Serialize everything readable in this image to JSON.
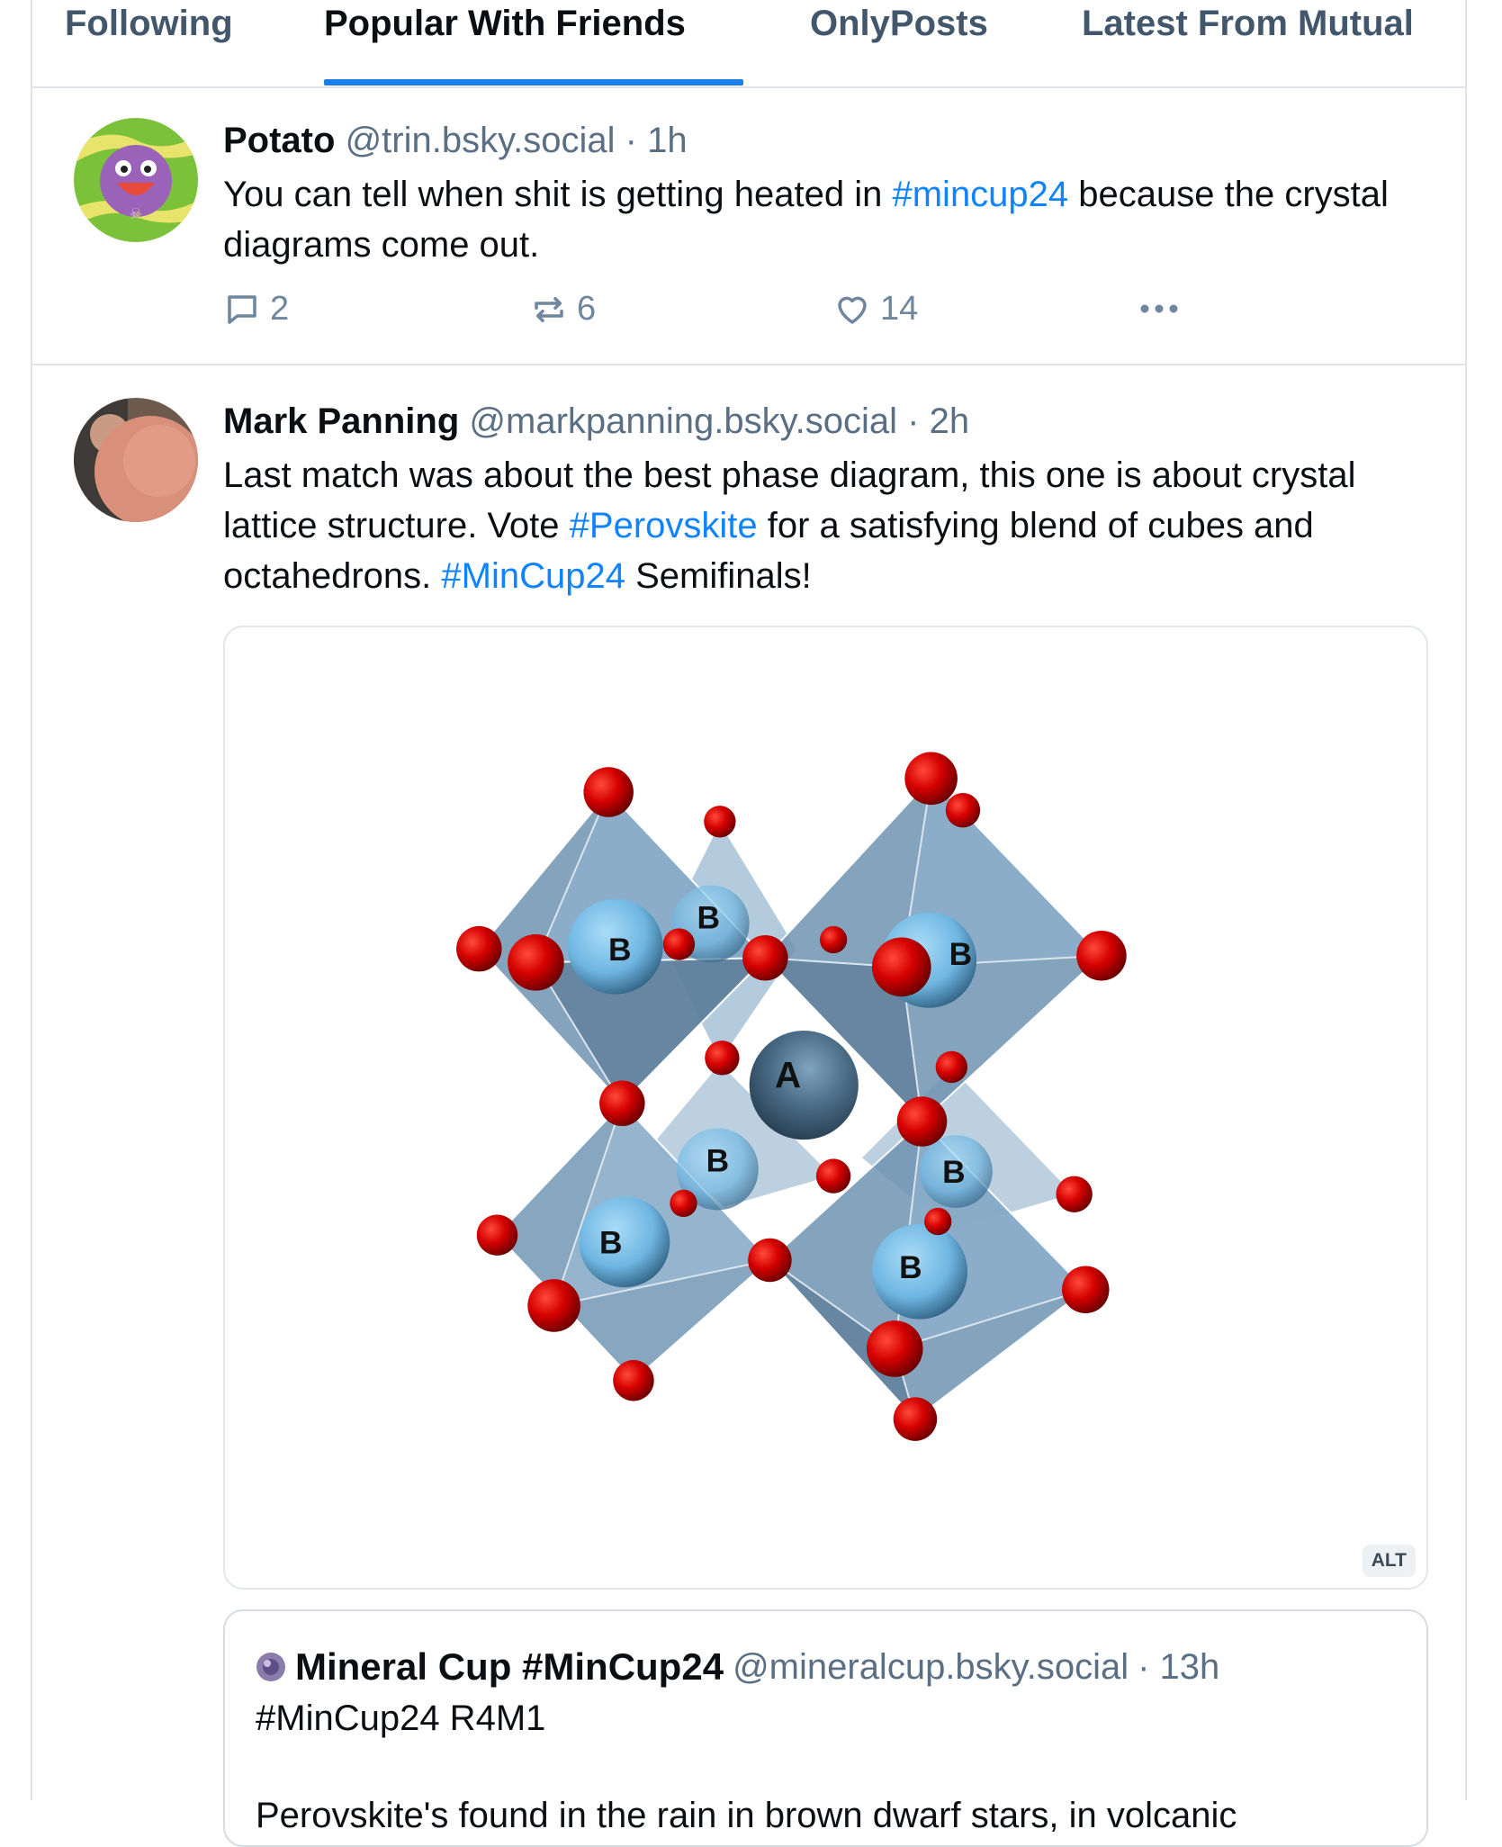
{
  "tabs": [
    {
      "label": "Following",
      "active": false
    },
    {
      "label": "Popular With Friends",
      "active": true
    },
    {
      "label": "OnlyPosts",
      "active": false
    },
    {
      "label": "Latest From Mutual",
      "active": false
    }
  ],
  "accent_color": "#1a7fe8",
  "posts": [
    {
      "author": "Potato",
      "handle": "@trin.bsky.social",
      "time": "· 1h",
      "text": [
        {
          "t": "You can tell when shit is getting heated in "
        },
        {
          "t": "#mincup24",
          "tag": true
        },
        {
          "t": " because the crystal diagrams come out."
        }
      ],
      "replies": "2",
      "reposts": "6",
      "likes": "14"
    },
    {
      "author": "Mark Panning",
      "handle": "@markpanning.bsky.social",
      "time": "· 2h",
      "text": [
        {
          "t": "Last match was about the best phase diagram, this one is about crystal lattice structure. Vote "
        },
        {
          "t": "#Perovskite",
          "tag": true
        },
        {
          "t": " for a satisfying blend of cubes and octahedrons. "
        },
        {
          "t": "#MinCup24",
          "tag": true
        },
        {
          "t": " Semifinals!"
        }
      ],
      "image": {
        "alt_badge": "ALT",
        "labels": {
          "a": "A",
          "b": "B"
        }
      },
      "quote": {
        "author": "Mineral Cup #MinCup24",
        "handle": "@mineralcup.bsky.social",
        "time": "· 13h",
        "line1": "#MinCup24 R4M1",
        "line2": "Perovskite's found in the rain in brown dwarf stars, in volcanic"
      }
    }
  ],
  "icons": {
    "reply": "speech-bubble-icon",
    "repost": "repost-arrows-icon",
    "like": "heart-icon",
    "more": "ellipsis-icon"
  }
}
